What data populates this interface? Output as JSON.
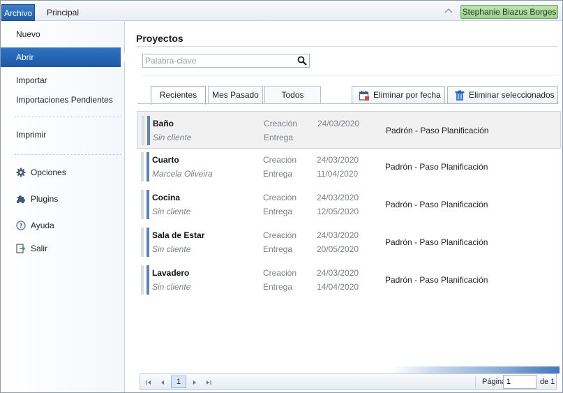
{
  "ribbon": {
    "tabs": [
      {
        "label": "Archivo",
        "active": true
      },
      {
        "label": "Principal",
        "active": false
      }
    ],
    "user_name": "Stephanie Biazus Borges",
    "user_badge_color": "#a8d99a"
  },
  "sidebar": {
    "items": [
      {
        "label": "Nuevo"
      },
      {
        "label": "Abrir",
        "active": true
      },
      {
        "label": "Importar"
      },
      {
        "label": "Importaciones Pendientes"
      },
      {
        "label": "Imprimir"
      },
      {
        "label": "Opciones",
        "icon": "gear-icon"
      },
      {
        "label": "Plugins",
        "icon": "puzzle-icon"
      },
      {
        "label": "Ayuda",
        "icon": "help-icon"
      },
      {
        "label": "Salir",
        "icon": "exit-icon"
      }
    ],
    "accent_color": "#1f5ea8"
  },
  "main": {
    "title": "Proyectos",
    "search": {
      "placeholder": "Palabra-clave",
      "value": ""
    },
    "tabs": [
      {
        "label": "Recientes",
        "active": true
      },
      {
        "label": "Mes Pasado",
        "active": false
      },
      {
        "label": "Todos",
        "active": false
      }
    ],
    "actions": {
      "delete_by_date": "Eliminar por fecha",
      "delete_selected": "Eliminar seleccionados"
    },
    "projects": [
      {
        "name": "Baño",
        "client": "Sin cliente",
        "created_label": "Creación",
        "created": "24/03/2020",
        "delivery_label": "Entrega",
        "delivery": "",
        "stage": "Padrón - Paso Planificación",
        "selected": true
      },
      {
        "name": "Cuarto",
        "client": "Marcela Oliveira",
        "created_label": "Creación",
        "created": "24/03/2020",
        "delivery_label": "Entrega",
        "delivery": "11/04/2020",
        "stage": "Padrón - Paso Planificación",
        "selected": false
      },
      {
        "name": "Cocina",
        "client": "Sin cliente",
        "created_label": "Creación",
        "created": "24/03/2020",
        "delivery_label": "Entrega",
        "delivery": "12/05/2020",
        "stage": "Padrón - Paso Planificación",
        "selected": false
      },
      {
        "name": "Sala de Estar",
        "client": "Sin cliente",
        "created_label": "Creación",
        "created": "24/03/2020",
        "delivery_label": "Entrega",
        "delivery": "20/05/2020",
        "stage": "Padrón - Paso Planificación",
        "selected": false
      },
      {
        "name": "Lavadero",
        "client": "Sin cliente",
        "created_label": "Creación",
        "created": "24/03/2020",
        "delivery_label": "Entrega",
        "delivery": "14/04/2020",
        "stage": "Padrón - Paso Planificación",
        "selected": false
      }
    ],
    "pager": {
      "current_page": "1",
      "page_label": "Página",
      "page_input": "1",
      "of_label": "de 1"
    }
  }
}
